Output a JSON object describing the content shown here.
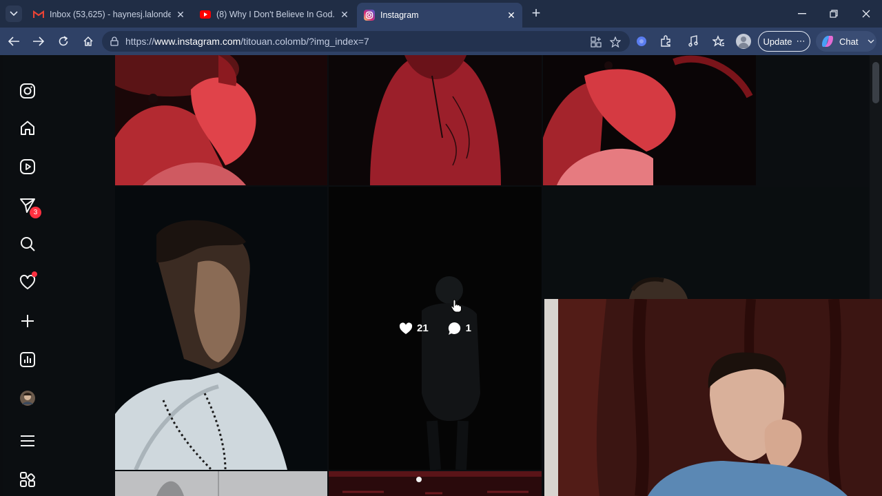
{
  "browser": {
    "tabs": [
      {
        "title": "Inbox (53,625) - haynesj.lalonde@",
        "icon": "gmail-icon",
        "active": false
      },
      {
        "title": "(8) Why I Don't Believe In God. - Yo",
        "icon": "youtube-icon",
        "active": false
      },
      {
        "title": "Instagram",
        "icon": "instagram-icon",
        "active": true
      }
    ],
    "url_prefix": "https://",
    "url_domain": "www.instagram.com",
    "url_path": "/titouan.colomb/?img_index=7",
    "update_label": "Update",
    "update_more": "⋯",
    "chat_label": "Chat"
  },
  "sidebar": {
    "items": [
      {
        "name": "instagram-logo-icon"
      },
      {
        "name": "home-icon"
      },
      {
        "name": "reels-icon"
      },
      {
        "name": "messages-icon",
        "badge": "3"
      },
      {
        "name": "search-icon"
      },
      {
        "name": "notifications-heart-icon",
        "dot": true
      },
      {
        "name": "create-plus-icon"
      },
      {
        "name": "dashboard-icon"
      },
      {
        "name": "profile-avatar"
      },
      {
        "name": "more-menu-icon"
      },
      {
        "name": "also-from-meta-icon"
      }
    ]
  },
  "grid": {
    "hover_post": {
      "likes": "21",
      "comments": "1"
    }
  },
  "colors": {
    "chrome_dark": "#202d45",
    "chrome_active": "#2f4166",
    "notification_red": "#ff3040"
  }
}
